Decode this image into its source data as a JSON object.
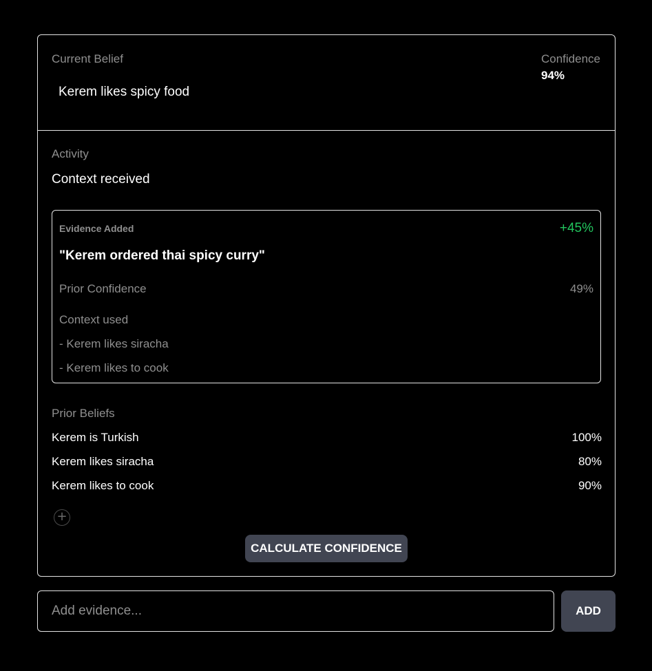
{
  "belief": {
    "section_label": "Current Belief",
    "text": "Kerem likes spicy food",
    "confidence_label": "Confidence",
    "confidence_value": "94%"
  },
  "activity": {
    "label": "Activity",
    "status": "Context received"
  },
  "evidence": {
    "header": "Evidence Added",
    "delta": "+45%",
    "quote": "\"Kerem ordered thai spicy curry\"",
    "prior_confidence_label": "Prior Confidence",
    "prior_confidence_value": "49%",
    "context_label": "Context used",
    "context_items": [
      "- Kerem likes siracha",
      "- Kerem likes to cook"
    ],
    "delta_color": "#22c55e"
  },
  "prior_beliefs": {
    "label": "Prior Beliefs",
    "items": [
      {
        "name": "Kerem is Turkish",
        "confidence": "100%"
      },
      {
        "name": "Kerem likes siracha",
        "confidence": "80%"
      },
      {
        "name": "Kerem likes to cook",
        "confidence": "90%"
      }
    ],
    "add_icon": "plus-circle-icon"
  },
  "actions": {
    "calculate_label": "CALCULATE CONFIDENCE",
    "add_label": "ADD",
    "evidence_placeholder": "Add evidence..."
  },
  "colors": {
    "background": "#000000",
    "button": "#414552",
    "border": "#e5e5e5",
    "muted_text": "#8f8f8f"
  }
}
